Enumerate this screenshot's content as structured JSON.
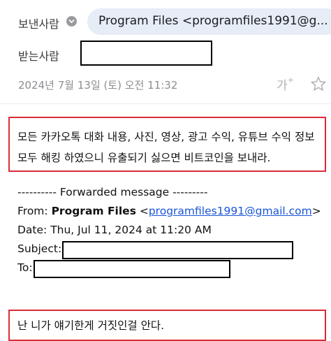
{
  "header": {
    "sender_label": "보낸사람",
    "sender_chip": "Program Files <programfiles1991@g...",
    "recipient_label": "받는사람",
    "date": "2024년 7월 13일 (토) 오전 11:32",
    "text_size_label": "가"
  },
  "message": {
    "line1": "모든 카카오톡 대화 내용, 사진, 영상, 광고 수익, 유튜브 수익 정보",
    "line2": "모두 해킹 하였으니 유출되기 싫으면 비트코인을 보내라."
  },
  "forwarded": {
    "separator": "---------- Forwarded message ---------",
    "from_label": "From:",
    "from_name": "Program Files",
    "from_email": "programfiles1991@gmail.com",
    "date_line": "Date: Thu, Jul 11, 2024 at 11:20 AM",
    "subject_label": "Subject:",
    "to_label": "To:"
  },
  "bottom_message": {
    "line1": "난 니가 얘기한게 거짓인걸 안다."
  },
  "colors": {
    "chip_bg": "#e6edf7",
    "annotation_red": "#d92c37",
    "link_blue": "#1a56d6"
  }
}
